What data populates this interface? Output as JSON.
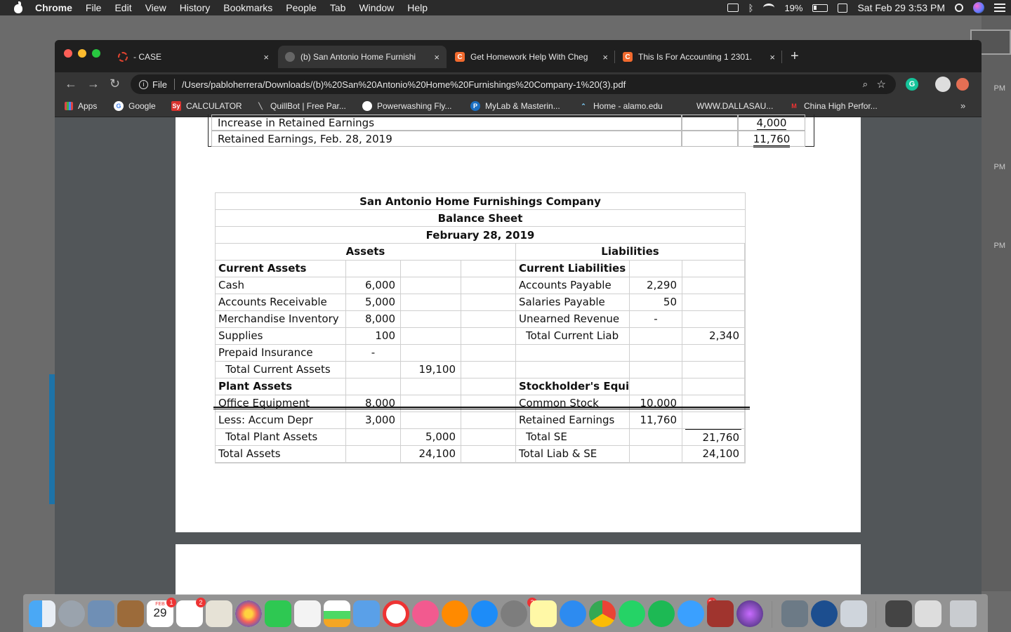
{
  "menubar": {
    "app": "Chrome",
    "items": [
      "File",
      "Edit",
      "View",
      "History",
      "Bookmarks",
      "People",
      "Tab",
      "Window",
      "Help"
    ],
    "battery": "19%",
    "datetime": "Sat Feb 29  3:53 PM"
  },
  "desktop": {
    "times": [
      "PM",
      "PM",
      "PM"
    ]
  },
  "tabs": [
    {
      "title": "- CASE",
      "close": "×"
    },
    {
      "title": "(b) San Antonio Home Furnishi",
      "close": "×"
    },
    {
      "title": "Get Homework Help With Cheg",
      "close": "×"
    },
    {
      "title": "This Is For Accounting 1 2301.",
      "close": "×"
    }
  ],
  "toolbar": {
    "file_label": "File",
    "url": "/Users/pabloherrera/Downloads/(b)%20San%20Antonio%20Home%20Furnishings%20Company-1%20(3).pdf"
  },
  "bookmarks": [
    {
      "label": "Apps"
    },
    {
      "label": "Google"
    },
    {
      "label": "CALCULATOR"
    },
    {
      "label": "QuillBot | Free Par..."
    },
    {
      "label": "Powerwashing Fly..."
    },
    {
      "label": "MyLab & Masterin..."
    },
    {
      "label": "Home - alamo.edu"
    },
    {
      "label": "WWW.DALLASAU..."
    },
    {
      "label": "China High Perfor..."
    }
  ],
  "retained_earnings_fragment": {
    "rows": [
      {
        "label": "Increase in Retained Earnings",
        "value": "4,000"
      },
      {
        "label": "Retained Earnings, Feb. 28, 2019",
        "value": "11,760"
      }
    ]
  },
  "balance_sheet": {
    "company": "San Antonio Home Furnishings Company",
    "statement": "Balance Sheet",
    "date": "February 28, 2019",
    "assets_header": "Assets",
    "liabilities_header": "Liabilities",
    "current_assets_header": "Current Assets",
    "cash": {
      "label": "Cash",
      "value": "6,000"
    },
    "ar": {
      "label": "Accounts Receivable",
      "value": "5,000"
    },
    "inventory": {
      "label": "Merchandise Inventory",
      "value": "8,000"
    },
    "supplies": {
      "label": "Supplies",
      "value": "100"
    },
    "prepaid": {
      "label": "Prepaid Insurance",
      "value": "-"
    },
    "total_current_assets": {
      "label": "Total Current Assets",
      "value": "19,100"
    },
    "plant_assets_header": "Plant Assets",
    "office_equipment": {
      "label": "Office Equipment",
      "value": "8,000"
    },
    "accum_depr": {
      "label": "Less: Accum Depr",
      "value": "3,000"
    },
    "total_plant_assets": {
      "label": "Total Plant Assets",
      "value": "5,000"
    },
    "total_assets": {
      "label": "Total Assets",
      "value": "24,100"
    },
    "current_liabilities_header": "Current Liabilities",
    "ap": {
      "label": "Accounts  Payable",
      "value": "2,290"
    },
    "salaries": {
      "label": "Salaries Payable",
      "value": "50"
    },
    "unearned": {
      "label": "Unearned Revenue",
      "value": "-"
    },
    "total_current_liab": {
      "label": "Total Current Liab",
      "value": "2,340"
    },
    "se_header": "Stockholder's Equity",
    "common_stock": {
      "label": "Common Stock",
      "value": "10,000"
    },
    "retained_earnings": {
      "label": "Retained Earnings",
      "value": "11,760"
    },
    "total_se": {
      "label": "Total SE",
      "value": "21,760"
    },
    "total_liab_se": {
      "label": "Total Liab & SE",
      "value": "24,100"
    }
  },
  "dock": {
    "calendar_month": "FEB",
    "calendar_day": "29",
    "badges": [
      "1",
      "2",
      "2",
      "26"
    ]
  }
}
